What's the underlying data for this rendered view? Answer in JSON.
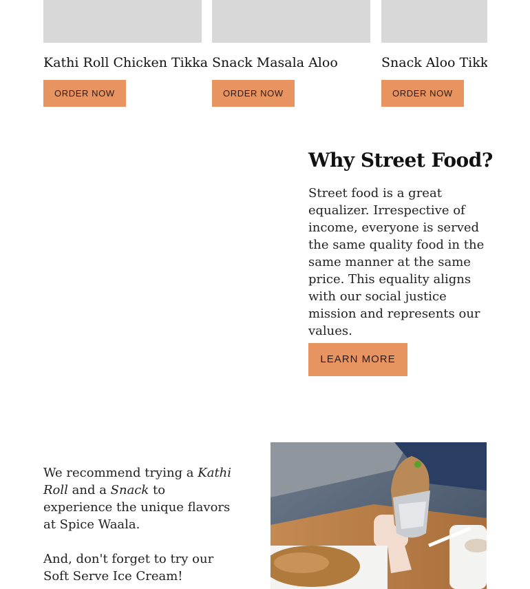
{
  "products": [
    {
      "name": "Kathi Roll Chicken Tikka",
      "order_label": "ORDER NOW"
    },
    {
      "name": "Snack Masala Aloo",
      "order_label": "ORDER NOW"
    },
    {
      "name": "Snack Aloo Tikki Ch",
      "order_label": "ORDER NOW"
    }
  ],
  "why_section": {
    "heading": "Why Street Food?",
    "body": "Street food is a great equalizer. Irrespective of income, everyone is served the same quality food in the same manner at the same price. This equality aligns with our social justice mission and represents our values.",
    "button_label": "LEARN MORE"
  },
  "recommend": {
    "part1": "We recommend trying a ",
    "kathi": "Kathi Roll",
    "part2": " and a ",
    "snack": "Snack",
    "part3": " to experience the unique flavors at Spice Waala.",
    "reminder": "And, don't forget to try our Soft Serve Ice Cream!"
  },
  "colors": {
    "accent": "#e89461",
    "placeholder": "#d8d8d8"
  }
}
